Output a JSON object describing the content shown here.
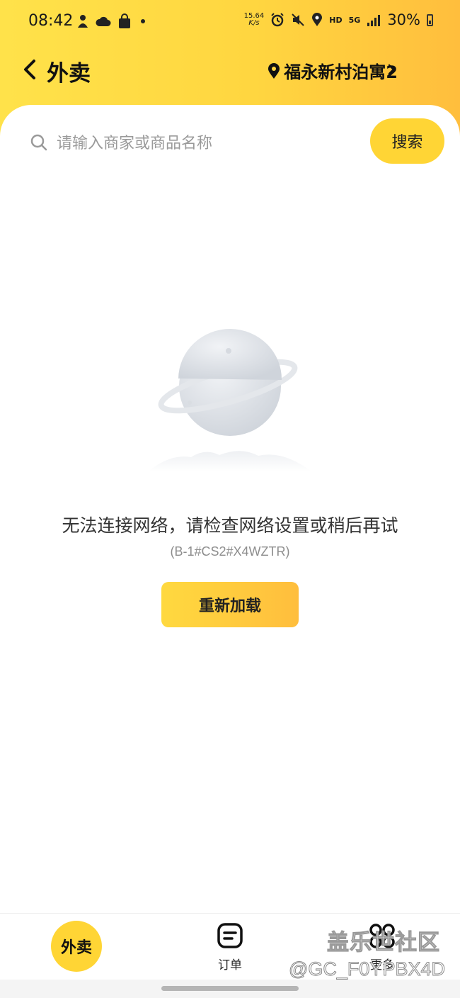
{
  "status_bar": {
    "time": "08:42",
    "net_speed_value": "15.64",
    "net_speed_unit": "K/s",
    "hd": "HD",
    "network": "5G",
    "battery": "30%"
  },
  "nav": {
    "title": "外卖",
    "location": "福永新村泊寓2"
  },
  "search": {
    "placeholder": "请输入商家或商品名称",
    "button_label": "搜索"
  },
  "error": {
    "message": "无法连接网络，请检查网络设置或稍后再试",
    "code": "(B-1#CS2#X4WZTR)",
    "reload_label": "重新加载"
  },
  "tabs": [
    {
      "label": "外卖",
      "active": true
    },
    {
      "label": "订单",
      "active": false
    },
    {
      "label": "更多",
      "active": false
    }
  ],
  "watermark": {
    "site": "盖乐世社区",
    "user": "@GC_F0YPBX4D"
  },
  "colors": {
    "accent": "#FFD535",
    "header_gradient_start": "#FFE24A",
    "header_gradient_end": "#FFBE3D"
  }
}
